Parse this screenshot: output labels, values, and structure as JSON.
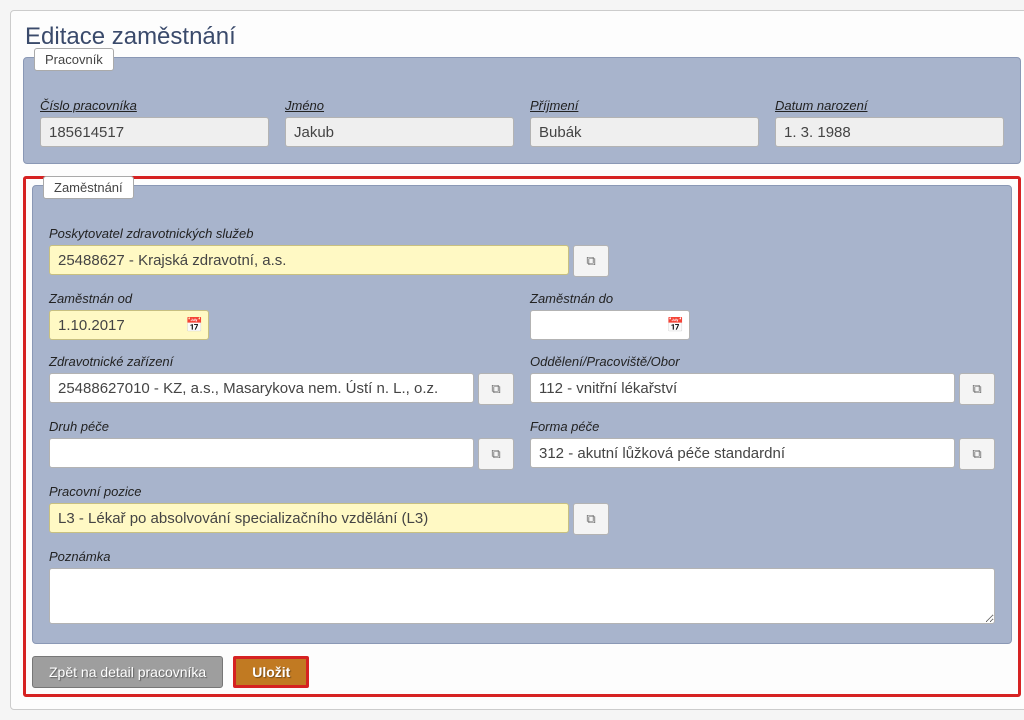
{
  "title": "Editace zaměstnání",
  "pracovnik": {
    "legend": "Pracovník",
    "cislo_label": "Číslo pracovníka",
    "cislo": "185614517",
    "jmeno_label": "Jméno",
    "jmeno": "Jakub",
    "prijmeni_label": "Příjmení",
    "prijmeni": "Bubák",
    "narozeni_label": "Datum narození",
    "narozeni": "1. 3. 1988"
  },
  "zamestnani": {
    "legend": "Zaměstnání",
    "poskytovatel_label": "Poskytovatel zdravotnických služeb",
    "poskytovatel": "25488627 - Krajská zdravotní, a.s.",
    "zamestnan_od_label": "Zaměstnán od",
    "zamestnan_od": "1.10.2017",
    "zamestnan_do_label": "Zaměstnán do",
    "zamestnan_do": "",
    "zarizeni_label": "Zdravotnické zařízení",
    "zarizeni": "25488627010 - KZ, a.s., Masarykova nem. Ústí n. L., o.z.",
    "oddeleni_label": "Oddělení/Pracoviště/Obor",
    "oddeleni": "112 - vnitřní lékařství",
    "druh_label": "Druh péče",
    "druh": "",
    "forma_label": "Forma péče",
    "forma": "312 - akutní lůžková péče standardní",
    "pozice_label": "Pracovní pozice",
    "pozice": "L3 - Lékař po absolvování specializačního vzdělání (L3)",
    "poznamka_label": "Poznámka",
    "poznamka": ""
  },
  "buttons": {
    "back": "Zpět na detail pracovníka",
    "save": "Uložit"
  }
}
